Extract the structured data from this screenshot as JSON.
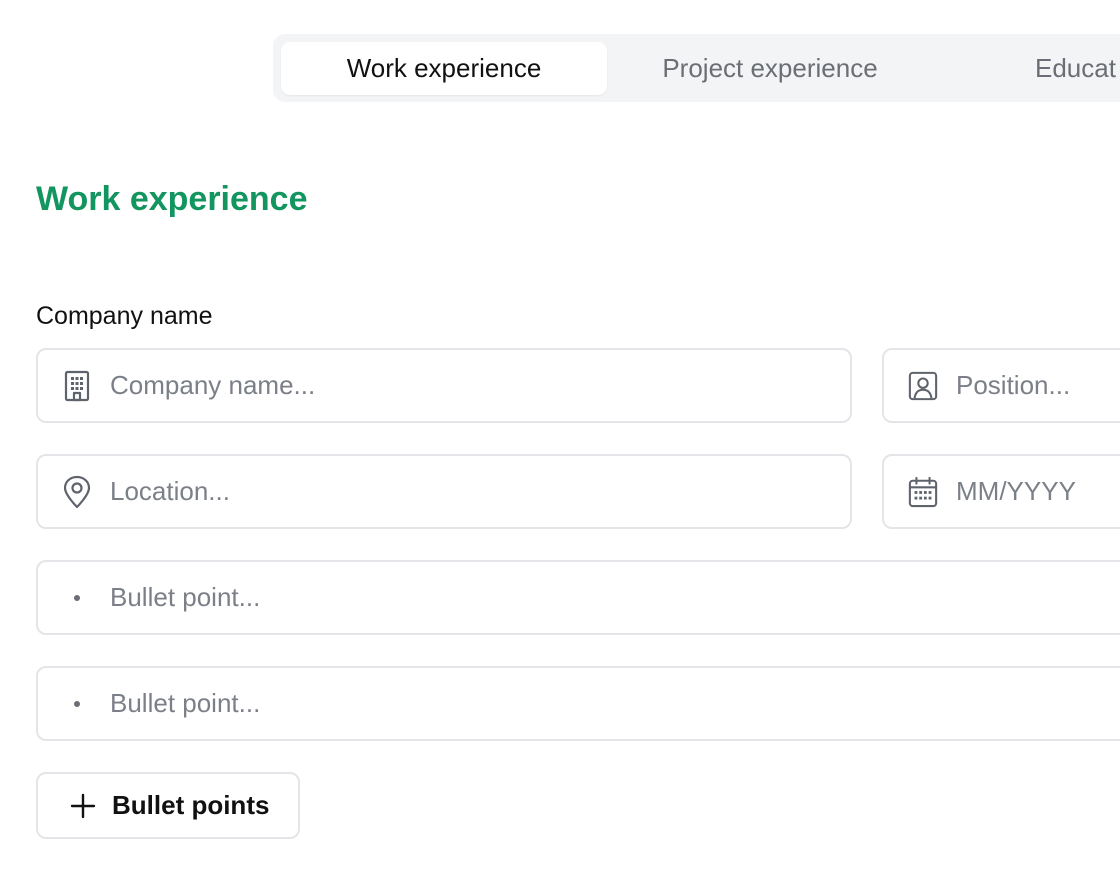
{
  "tabs": [
    {
      "label": "Work experience",
      "active": true
    },
    {
      "label": "Project experience",
      "active": false
    },
    {
      "label": "Educat",
      "active": false
    }
  ],
  "section": {
    "title": "Work experience"
  },
  "form": {
    "company_label": "Company name",
    "company": {
      "icon": "building-icon",
      "value": "",
      "placeholder": "Company name..."
    },
    "position": {
      "icon": "user-badge-icon",
      "value": "",
      "placeholder": "Position..."
    },
    "location": {
      "icon": "map-pin-icon",
      "value": "",
      "placeholder": "Location..."
    },
    "date": {
      "icon": "calendar-icon",
      "value": "",
      "placeholder": "MM/YYYY"
    },
    "bullets": [
      {
        "value": "",
        "placeholder": "Bullet point..."
      },
      {
        "value": "",
        "placeholder": "Bullet point..."
      }
    ],
    "add_bullets_label": "Bullet points"
  },
  "colors": {
    "accent": "#12955f",
    "tab_bg": "#f3f4f6",
    "border": "#e4e5e8",
    "placeholder": "#7b7f87",
    "icon": "#5f636b"
  }
}
